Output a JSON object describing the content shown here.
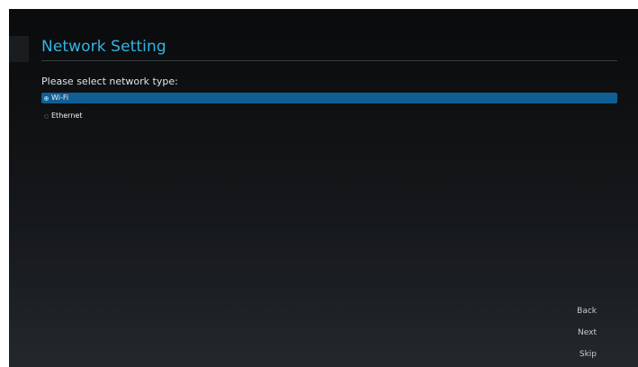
{
  "header": {
    "title": "Network Setting"
  },
  "main": {
    "prompt": "Please select network type:",
    "options": [
      {
        "label": "Wi-Fi",
        "selected": true
      },
      {
        "label": "Ethernet",
        "selected": false
      }
    ]
  },
  "navigation": {
    "back_label": "Back",
    "next_label": "Next",
    "skip_label": "Skip"
  },
  "colors": {
    "accent": "#33b5e5",
    "selection": "#0f5f94"
  }
}
